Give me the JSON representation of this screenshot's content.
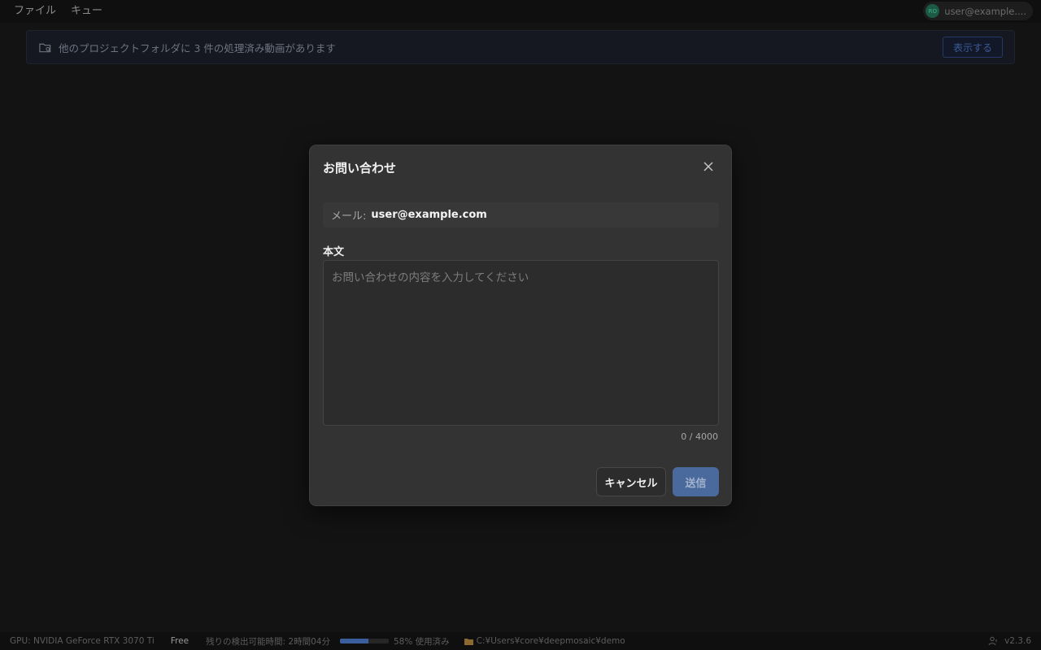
{
  "menu": {
    "items": [
      "ファイル",
      "キュー"
    ]
  },
  "account": {
    "initials": "RO",
    "email": "user@example...."
  },
  "banner": {
    "icon": "folder-search-icon",
    "text": "他のプロジェクトフォルダに 3 件の処理済み動画があります",
    "button_label": "表示する"
  },
  "dialog": {
    "title": "お問い合わせ",
    "close_icon": "close-icon",
    "email_label": "メール:",
    "email_value": "user@example.com",
    "body_label": "本文",
    "body_placeholder": "お問い合わせの内容を入力してください",
    "body_value": "",
    "char_count": "0 / 4000",
    "cancel_label": "キャンセル",
    "send_label": "送信"
  },
  "status": {
    "gpu": "GPU: NVIDIA GeForce RTX 3070 Ti",
    "plan": "Free",
    "remaining": "残りの検出可能時間: 2時間04分",
    "usage_percent": 58,
    "usage_text": "58% 使用済み",
    "path": "C:¥Users¥core¥deepmosaic¥demo",
    "version": "v2.3.6"
  },
  "colors": {
    "accent": "#4a6a9e",
    "background": "#131313",
    "dialog": "#333333"
  }
}
